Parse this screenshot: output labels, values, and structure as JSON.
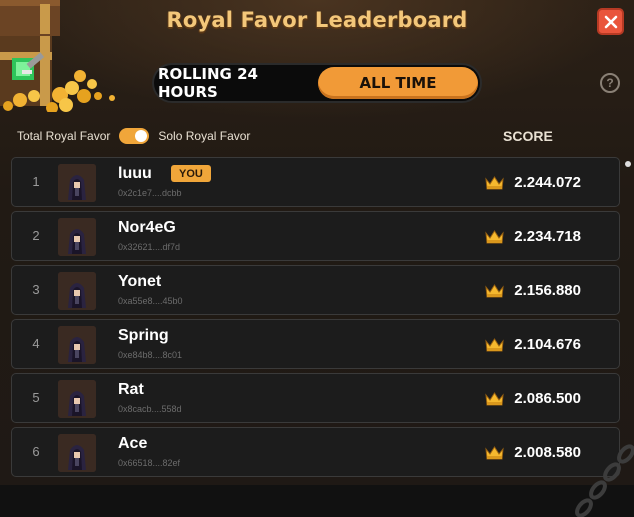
{
  "header": {
    "title": "Royal Favor Leaderboard"
  },
  "tabs": {
    "rolling": "ROLLING 24 HOURS",
    "all_time": "ALL TIME",
    "selected": "all_time"
  },
  "help_label": "?",
  "filter": {
    "left_label": "Total Royal Favor",
    "right_label": "Solo Royal Favor",
    "toggle_on": true
  },
  "columns": {
    "score": "SCORE"
  },
  "colors": {
    "accent": "#f0a63a",
    "close": "#e9553c",
    "title": "#f3c77a"
  },
  "rows": [
    {
      "rank": "1",
      "name": "luuu",
      "address": "0x2c1e7....dcbb",
      "score": "2.244.072",
      "you": "YOU"
    },
    {
      "rank": "2",
      "name": "Nor4eG",
      "address": "0x32621....df7d",
      "score": "2.234.718"
    },
    {
      "rank": "3",
      "name": "Yonet",
      "address": "0xa55e8....45b0",
      "score": "2.156.880"
    },
    {
      "rank": "4",
      "name": "Spring",
      "address": "0xe84b8....8c01",
      "score": "2.104.676"
    },
    {
      "rank": "5",
      "name": "Rat",
      "address": "0x8cacb....558d",
      "score": "2.086.500"
    },
    {
      "rank": "6",
      "name": "Ace",
      "address": "0x66518....82ef",
      "score": "2.008.580"
    }
  ]
}
